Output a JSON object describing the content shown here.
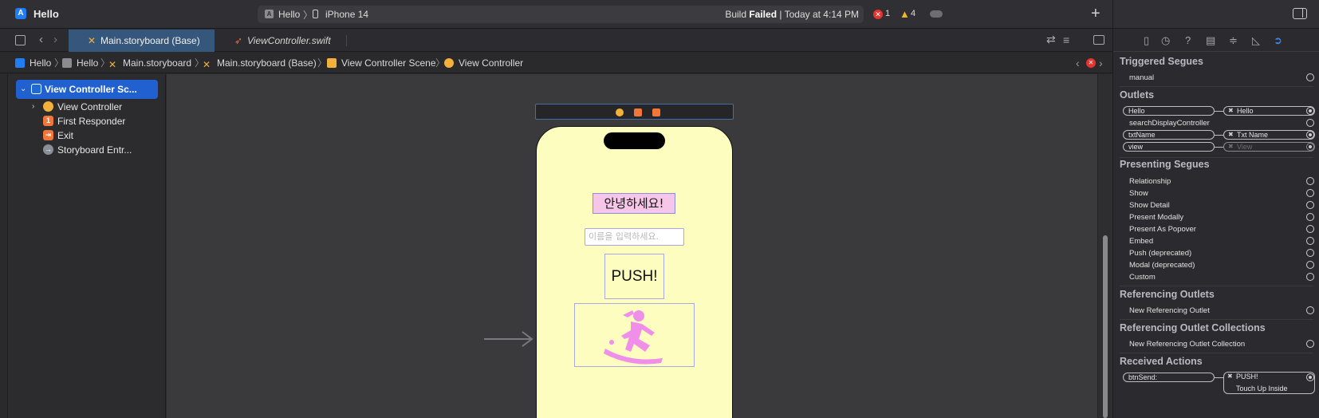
{
  "titlebar": {
    "app_name": "Hello",
    "scheme": "Hello",
    "device": "iPhone 14",
    "build_prefix": "Build",
    "build_result": "Failed",
    "build_time": "| Today at 4:14 PM",
    "error_count": "1",
    "warning_count": "4"
  },
  "tabs": [
    {
      "label": "Main.storyboard (Base)",
      "icon": "storyboard-icon",
      "active": true
    },
    {
      "label": "ViewController.swift",
      "icon": "swift-icon",
      "active": false
    }
  ],
  "breadcrumbs": [
    "Hello",
    "Hello",
    "Main.storyboard",
    "Main.storyboard (Base)",
    "View Controller Scene",
    "View Controller"
  ],
  "outline": {
    "scene": "View Controller Sc...",
    "items": [
      "View Controller",
      "First Responder",
      "Exit",
      "Storyboard Entr..."
    ]
  },
  "canvas": {
    "greeting": "안녕하세요!",
    "name_placeholder": "이름을 입력하세요.",
    "push_label": "PUSH!",
    "image_icon": "surfing-person-icon",
    "background_color": "#fdfdc0",
    "label_background": "#f6c6e8",
    "icon_color": "#ef8fea"
  },
  "inspector": {
    "triggered_segues": {
      "title": "Triggered Segues",
      "items": [
        "manual"
      ]
    },
    "outlets": {
      "title": "Outlets",
      "items": [
        {
          "name": "Hello",
          "target": "Hello",
          "connected": true
        },
        {
          "name": "searchDisplayController",
          "target": "",
          "connected": false
        },
        {
          "name": "txtName",
          "target": "Txt Name",
          "connected": true
        },
        {
          "name": "view",
          "target": "View",
          "connected": true
        }
      ]
    },
    "presenting_segues": {
      "title": "Presenting Segues",
      "items": [
        "Relationship",
        "Show",
        "Show Detail",
        "Present Modally",
        "Present As Popover",
        "Embed",
        "Push (deprecated)",
        "Modal (deprecated)",
        "Custom"
      ]
    },
    "referencing_outlets": {
      "title": "Referencing Outlets",
      "items": [
        "New Referencing Outlet"
      ]
    },
    "referencing_outlet_collections": {
      "title": "Referencing Outlet Collections",
      "items": [
        "New Referencing Outlet Collection"
      ]
    },
    "received_actions": {
      "title": "Received Actions",
      "action": "btnSend:",
      "target": "PUSH!",
      "event": "Touch Up Inside"
    }
  }
}
